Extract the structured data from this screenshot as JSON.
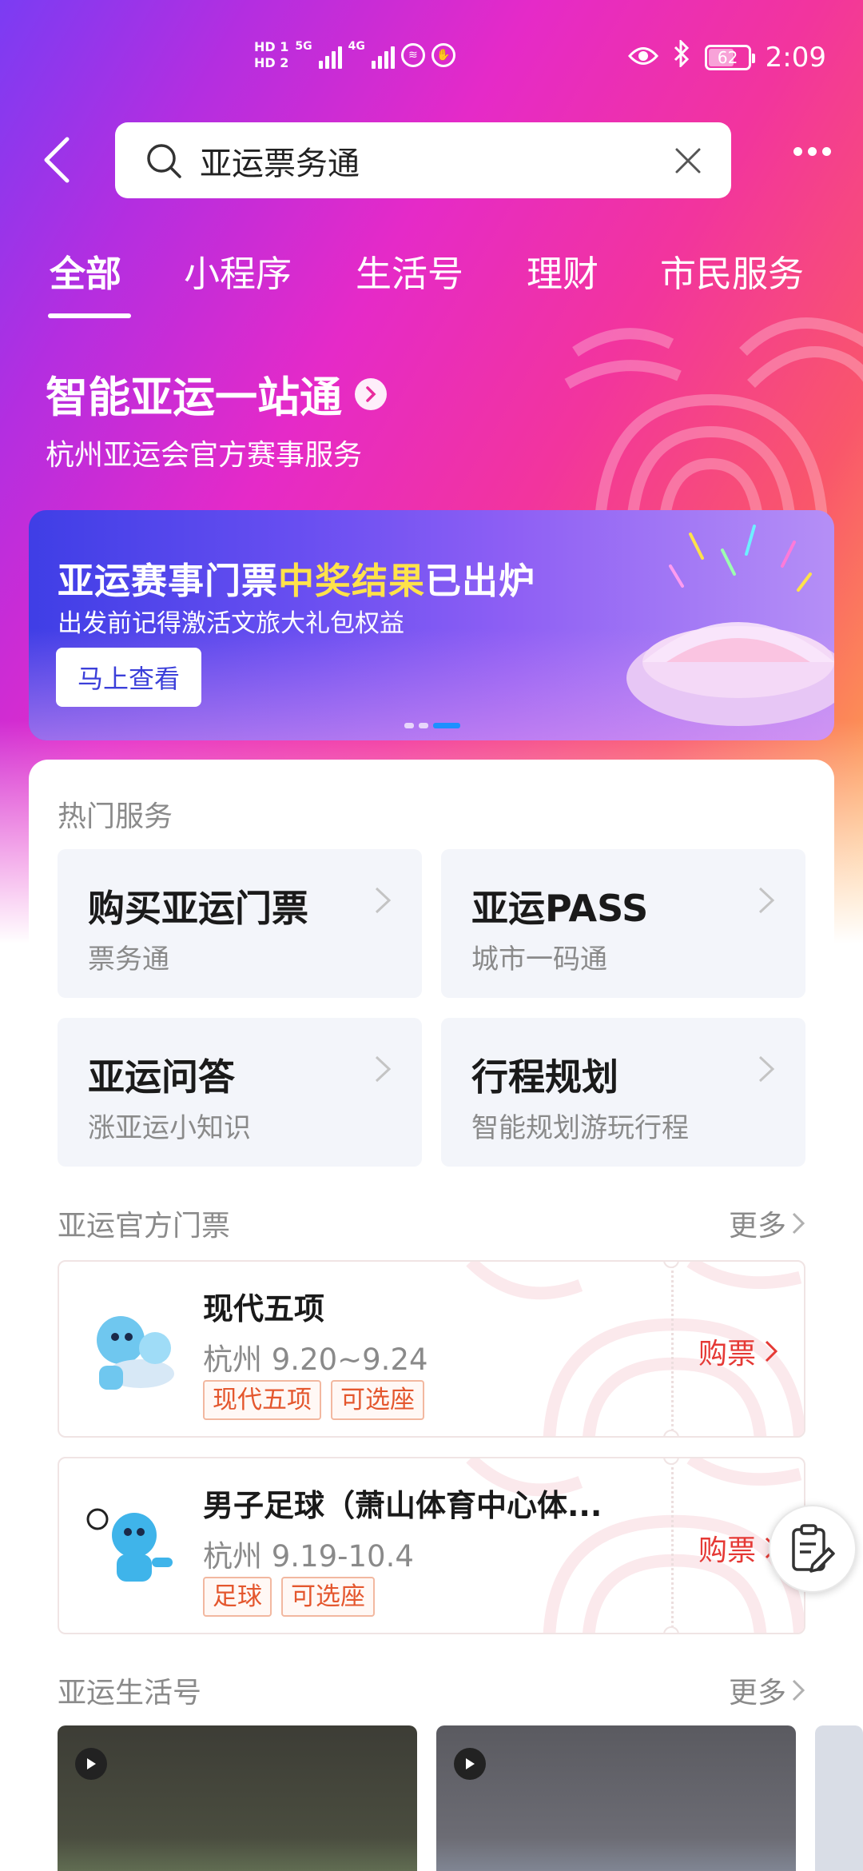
{
  "status_bar": {
    "time": "2:09",
    "battery": "62",
    "battery_level": 0.62,
    "hd1": "HD 1",
    "hd2": "HD 2",
    "net1": "5G",
    "net2": "4G"
  },
  "search": {
    "query": "亚运票务通"
  },
  "tabs": [
    {
      "label": "全部",
      "active": true
    },
    {
      "label": "小程序",
      "active": false
    },
    {
      "label": "生活号",
      "active": false
    },
    {
      "label": "理财",
      "active": false
    },
    {
      "label": "市民服务",
      "active": false
    }
  ],
  "hero": {
    "title": "智能亚运一站通",
    "subtitle": "杭州亚运会官方赛事服务"
  },
  "banner": {
    "title_part1": "亚运赛事门票",
    "title_highlight": "中奖结果",
    "title_part2": "已出炉",
    "subtitle": "出发前记得激活文旅大礼包权益",
    "button": "马上查看",
    "slide_count": 3,
    "active_slide": 3
  },
  "hot_services": {
    "title": "热门服务",
    "items": [
      {
        "name": "购买亚运门票",
        "sub": "票务通"
      },
      {
        "name": "亚运PASS",
        "sub": "城市一码通"
      },
      {
        "name": "亚运问答",
        "sub": "涨亚运小知识"
      },
      {
        "name": "行程规划",
        "sub": "智能规划游玩行程"
      }
    ]
  },
  "tickets": {
    "title": "亚运官方门票",
    "more": "更多",
    "items": [
      {
        "name": "现代五项",
        "date": "杭州 9.20~9.24",
        "tags": [
          "现代五项",
          "可选座"
        ],
        "action": "购票"
      },
      {
        "name": "男子足球（萧山体育中心体...",
        "date": "杭州 9.19-10.4",
        "tags": [
          "足球",
          "可选座"
        ],
        "action": "购票"
      }
    ]
  },
  "life": {
    "title": "亚运生活号",
    "more": "更多"
  },
  "colors": {
    "accent_red": "#e53935",
    "tag_orange": "#e4572e",
    "banner_highlight": "#ffe24a",
    "dot_active": "#1e90ff"
  },
  "icons": [
    "back-arrow-icon",
    "search-icon",
    "clear-icon",
    "more-dots-icon",
    "chevron-right-icon",
    "clipboard-edit-icon",
    "play-icon"
  ]
}
